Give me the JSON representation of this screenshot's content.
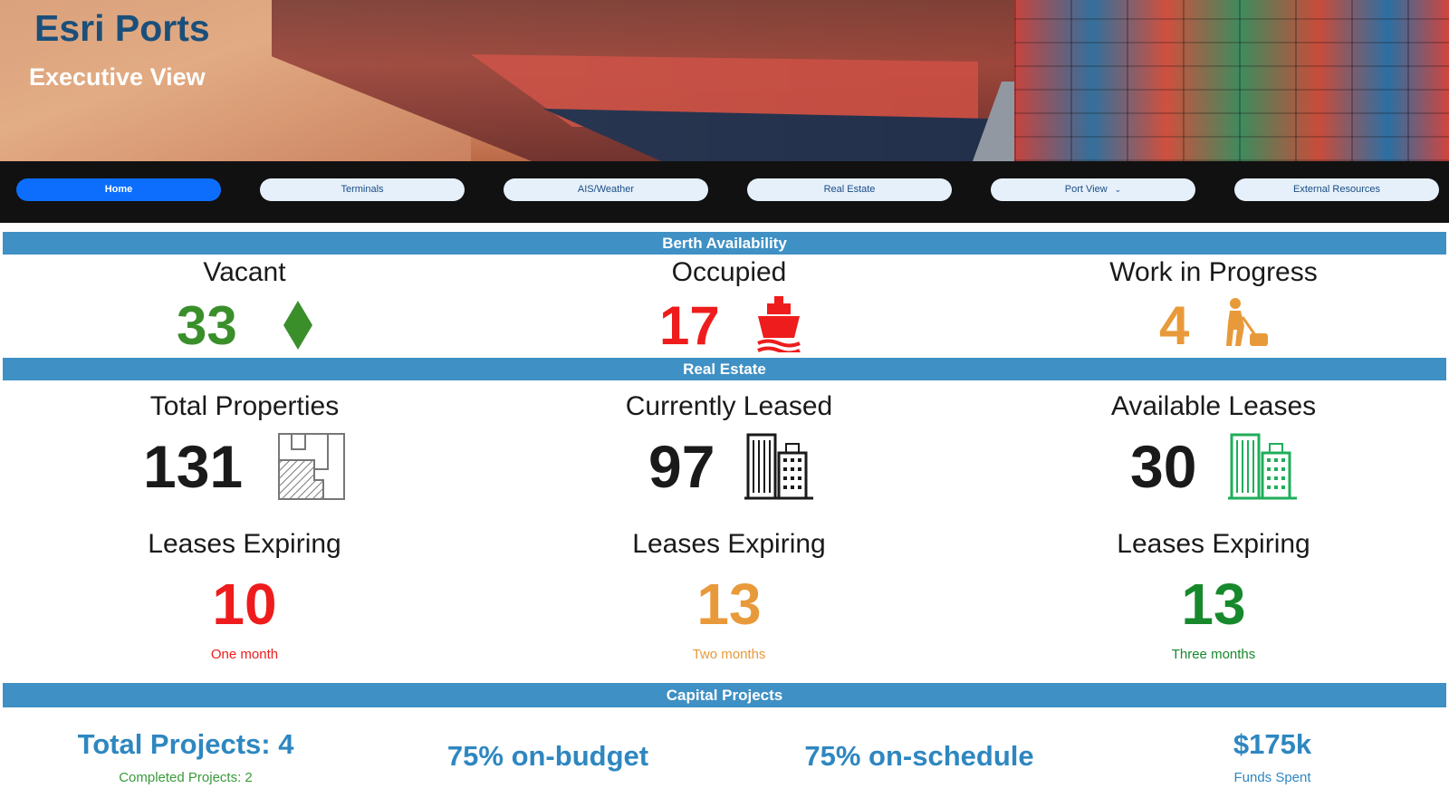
{
  "header": {
    "title": "Esri Ports",
    "subtitle": "Executive View"
  },
  "nav": {
    "items": [
      {
        "label": "Home",
        "active": true
      },
      {
        "label": "Terminals",
        "active": false
      },
      {
        "label": "AIS/Weather",
        "active": false
      },
      {
        "label": "Real Estate",
        "active": false
      },
      {
        "label": "Port View",
        "active": false,
        "dropdown": true
      },
      {
        "label": "External Resources",
        "active": false
      }
    ]
  },
  "berth": {
    "title": "Berth Availability",
    "vacant": {
      "label": "Vacant",
      "value": "33",
      "color": "#3a8f2b",
      "icon": "diamond-icon"
    },
    "occupied": {
      "label": "Occupied",
      "value": "17",
      "color": "#ee1c1c",
      "icon": "ship-icon"
    },
    "wip": {
      "label": "Work in Progress",
      "value": "4",
      "color": "#e89a3a",
      "icon": "worker-icon"
    }
  },
  "real_estate": {
    "title": "Real Estate",
    "total": {
      "label": "Total Properties",
      "value": "131",
      "icon": "parcels-icon"
    },
    "leased": {
      "label": "Currently Leased",
      "value": "97",
      "icon": "buildings-icon"
    },
    "available": {
      "label": "Available Leases",
      "value": "30",
      "icon": "buildings-green-icon",
      "color": "#1fae5a"
    },
    "expiring": [
      {
        "label": "Leases Expiring",
        "value": "10",
        "period": "One month",
        "color": "#ee1c1c"
      },
      {
        "label": "Leases Expiring",
        "value": "13",
        "period": "Two months",
        "color": "#e89a3a"
      },
      {
        "label": "Leases Expiring",
        "value": "13",
        "period": "Three months",
        "color": "#17892c"
      }
    ]
  },
  "capital": {
    "title": "Capital Projects",
    "total": "Total Projects: 4",
    "completed": "Completed Projects: 2",
    "budget": "75% on-budget",
    "schedule": "75% on-schedule",
    "funds": "$175k",
    "funds_label": "Funds Spent"
  }
}
